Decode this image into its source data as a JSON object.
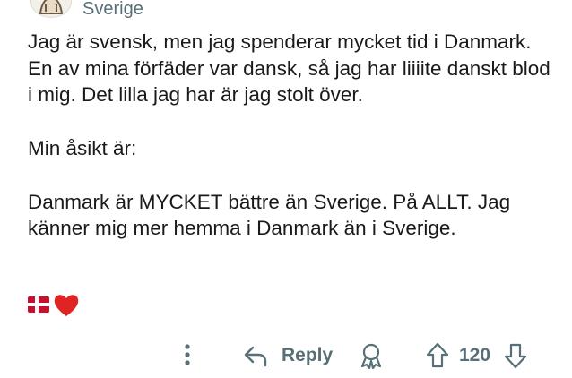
{
  "comment": {
    "flair": "Sverige",
    "paragraphs": [
      "Jag är svensk, men jag spenderar mycket tid i Danmark. En av mina förfäder var dansk, så jag har liiiite danskt blod i mig. Det lilla jag har är jag stolt över.",
      "Min åsikt är:",
      "Danmark är MYCKET bättre än Sverige. På ALLT. Jag känner mig mer hemma i Danmark än i Sverige."
    ],
    "emojis": [
      "flag-denmark",
      "red-heart"
    ]
  },
  "actions": {
    "reply_label": "Reply",
    "score": "120",
    "icons": [
      "more-vertical-icon",
      "reply-arrow-icon",
      "award-icon",
      "upvote-icon",
      "downvote-icon"
    ]
  },
  "colors": {
    "text": "#1a1a1b",
    "muted": "#576f76",
    "flag_red": "#c8102e",
    "heart_red": "#e02424"
  }
}
